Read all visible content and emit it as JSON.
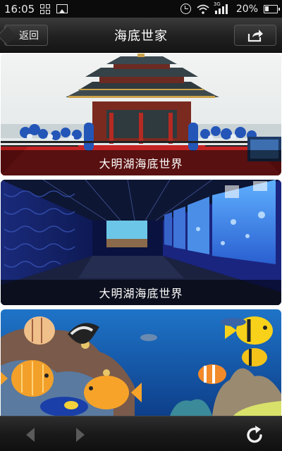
{
  "status_bar": {
    "time": "16:05",
    "network": "3G",
    "battery": "20%",
    "icons": [
      "grid-icon",
      "image-icon",
      "alarm-icon",
      "wifi-icon",
      "signal-icon",
      "battery-icon"
    ]
  },
  "header": {
    "back_label": "返回",
    "title": "海底世家",
    "share_icon": "share-icon"
  },
  "cards": [
    {
      "caption": "大明湖海底世界",
      "image": "pavilion-entrance-photo"
    },
    {
      "caption": "大明湖海底世界",
      "image": "aquarium-tunnel-photo"
    },
    {
      "caption": "",
      "image": "tropical-fish-photo"
    }
  ],
  "toolbar": {
    "icons": [
      "nav-back-icon",
      "nav-forward-icon",
      "refresh-icon"
    ]
  },
  "colors": {
    "bar_dark": "#1a1a1a",
    "caption_overlay": "rgba(0,0,0,0.55)"
  }
}
